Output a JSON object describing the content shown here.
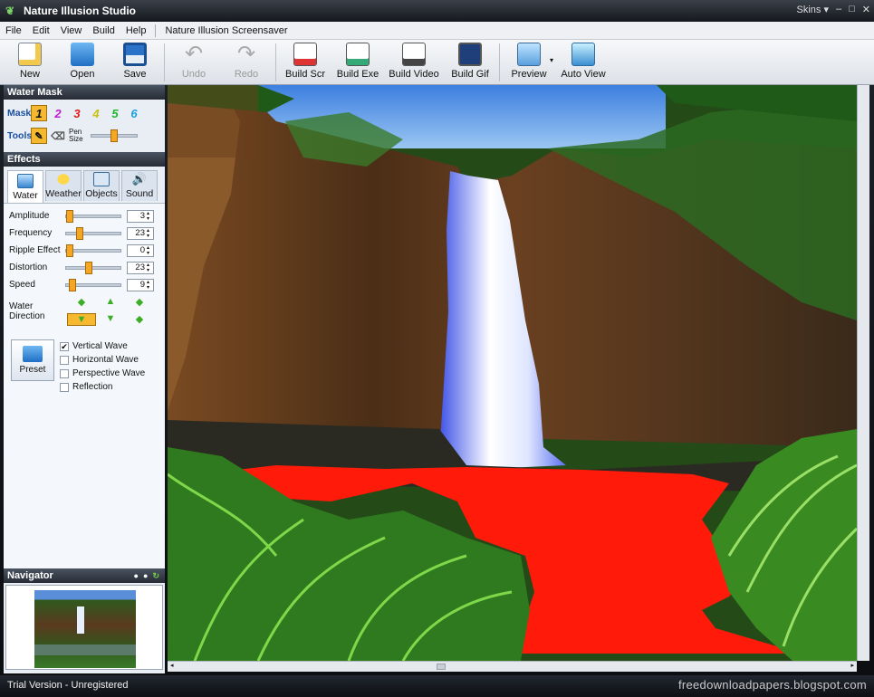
{
  "app": {
    "title": "Nature Illusion Studio",
    "skins_label": "Skins",
    "min_glyph": "–",
    "max_glyph": "□",
    "close_glyph": "✕"
  },
  "menu": {
    "items": [
      "File",
      "Edit",
      "View",
      "Build",
      "Help"
    ],
    "extra": "Nature Illusion Screensaver"
  },
  "toolbar": {
    "new": "New",
    "open": "Open",
    "save": "Save",
    "undo": "Undo",
    "redo": "Redo",
    "build_scr": "Build Scr",
    "build_exe": "Build Exe",
    "build_video": "Build Video",
    "build_gif": "Build Gif",
    "preview": "Preview",
    "auto_view": "Auto View"
  },
  "water_mask": {
    "title": "Water Mask",
    "mask_label": "Mask",
    "tools_label": "Tools",
    "pen_size_label": "Pen Size",
    "masks": [
      "1",
      "2",
      "3",
      "4",
      "5",
      "6"
    ],
    "pen_size_level": 0.4
  },
  "effects": {
    "title": "Effects",
    "tabs": [
      "Water",
      "Weather",
      "Objects",
      "Sound"
    ],
    "sliders": [
      {
        "label": "Amplitude",
        "value": "3",
        "level": 0.0
      },
      {
        "label": "Frequency",
        "value": "23",
        "level": 0.2
      },
      {
        "label": "Ripple Effect",
        "value": "0",
        "level": 0.0
      },
      {
        "label": "Distortion",
        "value": "23",
        "level": 0.38
      },
      {
        "label": "Speed",
        "value": "9",
        "level": 0.05
      }
    ],
    "water_direction_label": "Water Direction",
    "preset_label": "Preset",
    "options": [
      {
        "label": "Vertical Wave",
        "checked": true
      },
      {
        "label": "Horizontal Wave",
        "checked": false
      },
      {
        "label": "Perspective Wave",
        "checked": false
      },
      {
        "label": "Reflection",
        "checked": false
      }
    ]
  },
  "navigator": {
    "title": "Navigator"
  },
  "status": {
    "text": "Trial Version - Unregistered",
    "watermark": "freedownloadpapers.blogspot.com"
  },
  "colors": {
    "mask_red": "#ff1a0a",
    "accent_orange": "#f5a623",
    "arrow_green": "#3cae25"
  }
}
